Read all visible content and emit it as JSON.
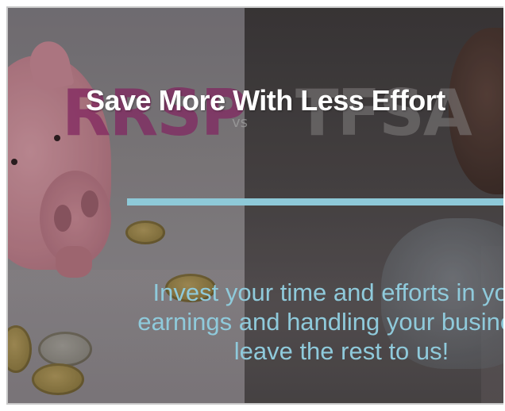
{
  "banner": {
    "headline": "Save More With Less Effort",
    "body": "Invest your time and efforts in your\nearnings and handling your business,\nleave the rest to us!",
    "background_words": {
      "left": "RRSP",
      "middle": "vs",
      "right": "TFSA"
    }
  },
  "colors": {
    "headline": "#ffffff",
    "divider": "#8ec9d8",
    "body_text": "#8fcadb",
    "rrsp_word": "#96286e",
    "frame_border": "#c9c9c9"
  }
}
